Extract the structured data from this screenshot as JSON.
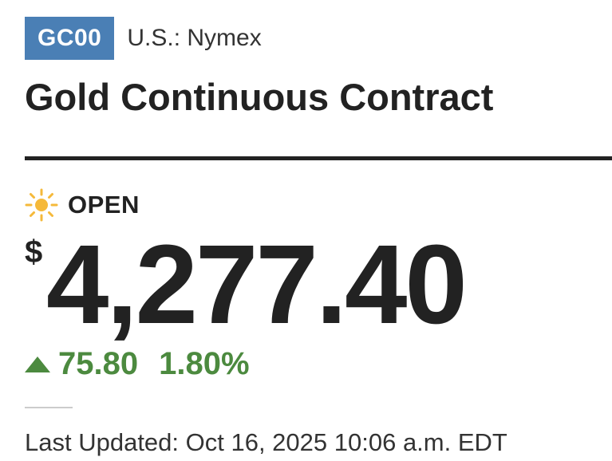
{
  "quote": {
    "ticker": "GC00",
    "exchange": "U.S.: Nymex",
    "name": "Gold Continuous Contract",
    "market_status": "OPEN",
    "market_status_icon": "sun-icon",
    "currency_symbol": "$",
    "price": "4,277.40",
    "change": "75.80",
    "change_percent": "1.80%",
    "change_direction_icon": "triangle-up-icon",
    "last_updated": "Last Updated: Oct 16, 2025 10:06 a.m. EDT"
  },
  "colors": {
    "badge_bg": "#4a7fb5",
    "positive": "#4c8a3f",
    "sun": "#f5b93a",
    "text": "#222222"
  }
}
